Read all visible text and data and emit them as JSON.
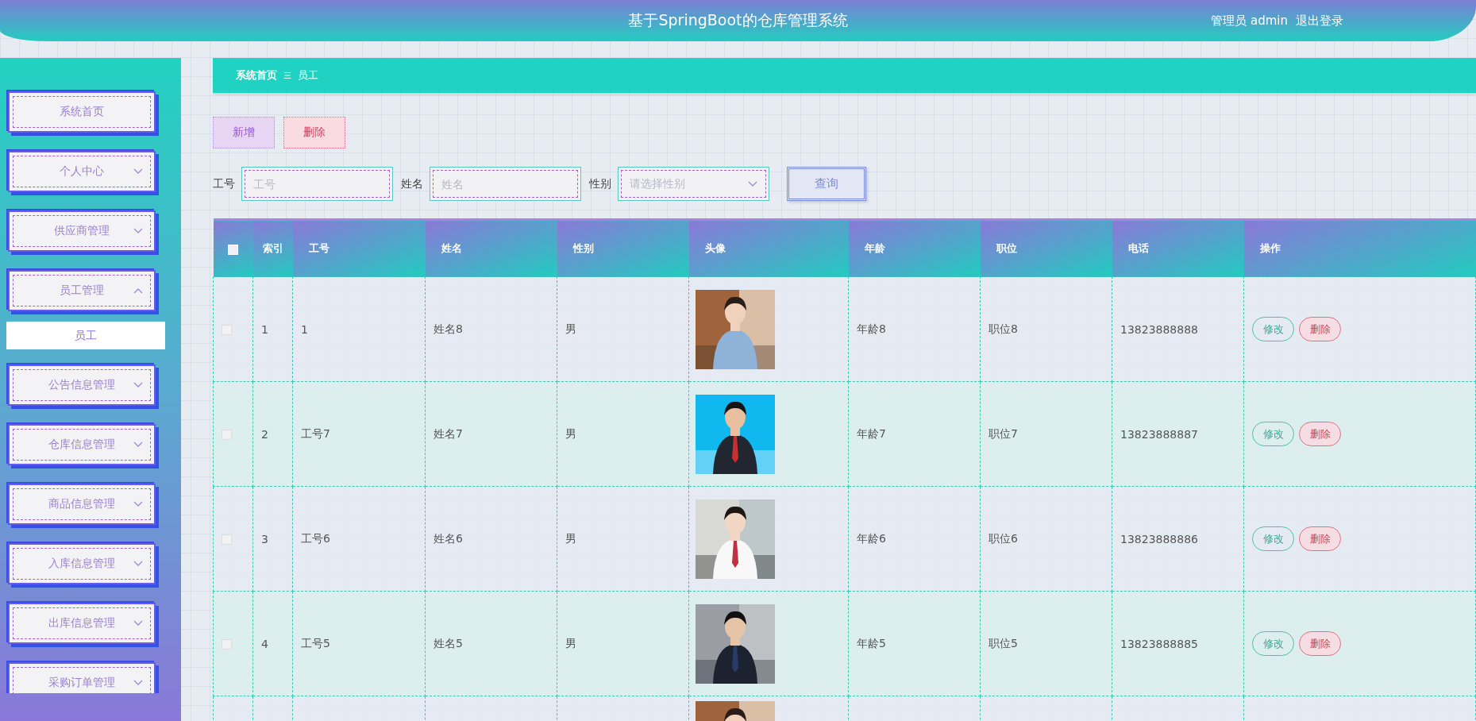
{
  "header": {
    "title": "基于SpringBoot的仓库管理系统",
    "user": "管理员 admin",
    "logout": "退出登录"
  },
  "sidebar": {
    "items": [
      {
        "label": "系统首页",
        "kind": "link"
      },
      {
        "label": "个人中心",
        "kind": "menu",
        "expanded": false
      },
      {
        "label": "供应商管理",
        "kind": "menu",
        "expanded": false
      },
      {
        "label": "员工管理",
        "kind": "menu",
        "expanded": true,
        "children": [
          {
            "label": "员工",
            "selected": true
          }
        ]
      },
      {
        "label": "公告信息管理",
        "kind": "menu",
        "expanded": false
      },
      {
        "label": "仓库信息管理",
        "kind": "menu",
        "expanded": false
      },
      {
        "label": "商品信息管理",
        "kind": "menu",
        "expanded": false
      },
      {
        "label": "入库信息管理",
        "kind": "menu",
        "expanded": false
      },
      {
        "label": "出库信息管理",
        "kind": "menu",
        "expanded": false
      },
      {
        "label": "采购订单管理",
        "kind": "menu",
        "expanded": false
      }
    ]
  },
  "breadcrumb": [
    {
      "label": "系统首页"
    },
    {
      "label": "员工"
    }
  ],
  "toolbar": {
    "buttons": [
      {
        "label": "新增",
        "kind": "add"
      },
      {
        "label": "删除",
        "kind": "delete"
      }
    ]
  },
  "search": {
    "fields": [
      {
        "label": "工号",
        "placeholder": "工号",
        "kind": "input"
      },
      {
        "label": "姓名",
        "placeholder": "姓名",
        "kind": "input"
      },
      {
        "label": "性别",
        "placeholder": "请选择性别",
        "kind": "select"
      }
    ],
    "button": "查询"
  },
  "table": {
    "select_all": {
      "checked": false
    },
    "columns": [
      "索引",
      "工号",
      "姓名",
      "性别",
      "头像",
      "年龄",
      "职位",
      "电话",
      "操作"
    ],
    "rows": [
      {
        "checked": false,
        "index": "1",
        "job_no": "1",
        "name": "姓名8",
        "gender": "男",
        "avatar": {
          "kind": "picture"
        },
        "age": "年龄8",
        "position": "职位8",
        "phone": "13823888888",
        "actions": [
          {
            "label": "修改",
            "kind": "edit"
          },
          {
            "label": "删除",
            "kind": "delete"
          }
        ]
      },
      {
        "checked": false,
        "index": "2",
        "job_no": "工号7",
        "name": "姓名7",
        "gender": "男",
        "avatar": {
          "kind": "picture"
        },
        "age": "年龄7",
        "position": "职位7",
        "phone": "13823888887",
        "actions": [
          {
            "label": "修改",
            "kind": "edit"
          },
          {
            "label": "删除",
            "kind": "delete"
          }
        ]
      },
      {
        "checked": false,
        "index": "3",
        "job_no": "工号6",
        "name": "姓名6",
        "gender": "男",
        "avatar": {
          "kind": "picture"
        },
        "age": "年龄6",
        "position": "职位6",
        "phone": "13823888886",
        "actions": [
          {
            "label": "修改",
            "kind": "edit"
          },
          {
            "label": "删除",
            "kind": "delete"
          }
        ]
      },
      {
        "checked": false,
        "index": "4",
        "job_no": "工号5",
        "name": "姓名5",
        "gender": "男",
        "avatar": {
          "kind": "picture"
        },
        "age": "年龄5",
        "position": "职位5",
        "phone": "13823888885",
        "actions": [
          {
            "label": "修改",
            "kind": "edit"
          },
          {
            "label": "删除",
            "kind": "delete"
          }
        ]
      }
    ],
    "clipped_row": {
      "avatar": {
        "kind": "picture"
      }
    }
  }
}
